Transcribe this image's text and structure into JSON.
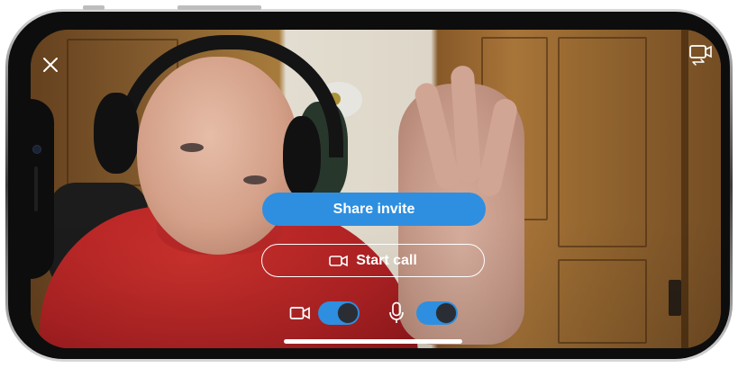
{
  "call": {
    "share_invite_label": "Share invite",
    "start_call_label": "Start call"
  },
  "controls": {
    "video_toggle_on": true,
    "mic_toggle_on": true
  },
  "icons": {
    "close": "close-icon",
    "switch_camera": "switch-camera-icon",
    "start_call": "video-call-icon",
    "video": "video-camera-icon",
    "mic": "microphone-icon"
  },
  "colors": {
    "accent": "#2e8fe0",
    "toggle_knob": "#2a2d33",
    "overlay_text": "#ffffff"
  }
}
